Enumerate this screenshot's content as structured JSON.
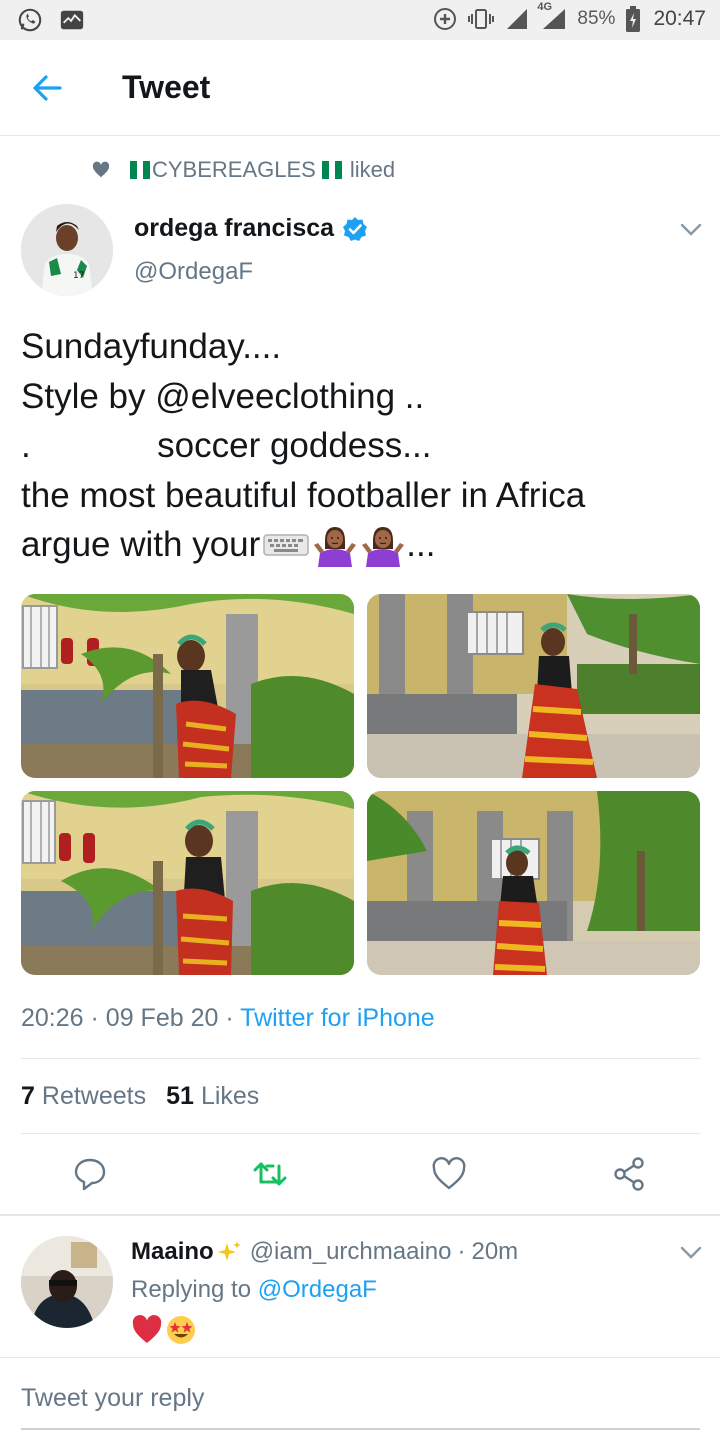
{
  "status_bar": {
    "left_icons": [
      "whatsapp-icon",
      "activity-icon"
    ],
    "right_icons": [
      "data-saver-icon",
      "vibrate-icon",
      "signal-icon",
      "signal-4g-icon",
      "battery-charging-icon"
    ],
    "network": "4G",
    "battery": "85%",
    "time": "20:47"
  },
  "header": {
    "title": "Tweet",
    "back_icon": "arrow-left-icon"
  },
  "social_context": {
    "icon": "heart-icon",
    "user": "CYBEREAGLES",
    "action": "liked"
  },
  "tweet": {
    "author_name": "ordega francisca",
    "author_handle": "@OrdegaF",
    "verified": true,
    "text_lines": [
      "Sundayfunday....",
      "Style by @elveeclothing ..",
      ".             soccer goddess...",
      "the most beautiful footballer in Africa",
      "argue with your"
    ],
    "text_tail": "...",
    "time": "20:26",
    "date": "09 Feb 20",
    "separator": "·",
    "source": "Twitter for iPhone",
    "retweets": "7",
    "retweets_label": "Retweets",
    "likes": "51",
    "likes_label": "Likes"
  },
  "actions": [
    "reply-icon",
    "retweet-icon",
    "like-icon",
    "share-icon"
  ],
  "reply": {
    "name": "Maaino",
    "handle": "@iam_urchmaaino",
    "time": "20m",
    "replying_label": "Replying to",
    "replying_to": "@OrdegaF"
  },
  "reply_input": {
    "placeholder": "Tweet your reply"
  },
  "colors": {
    "accent": "#1da1f2",
    "retweet": "#17bf63",
    "text": "#14171a",
    "secondary": "#657786",
    "divider": "#e1e8ed"
  }
}
